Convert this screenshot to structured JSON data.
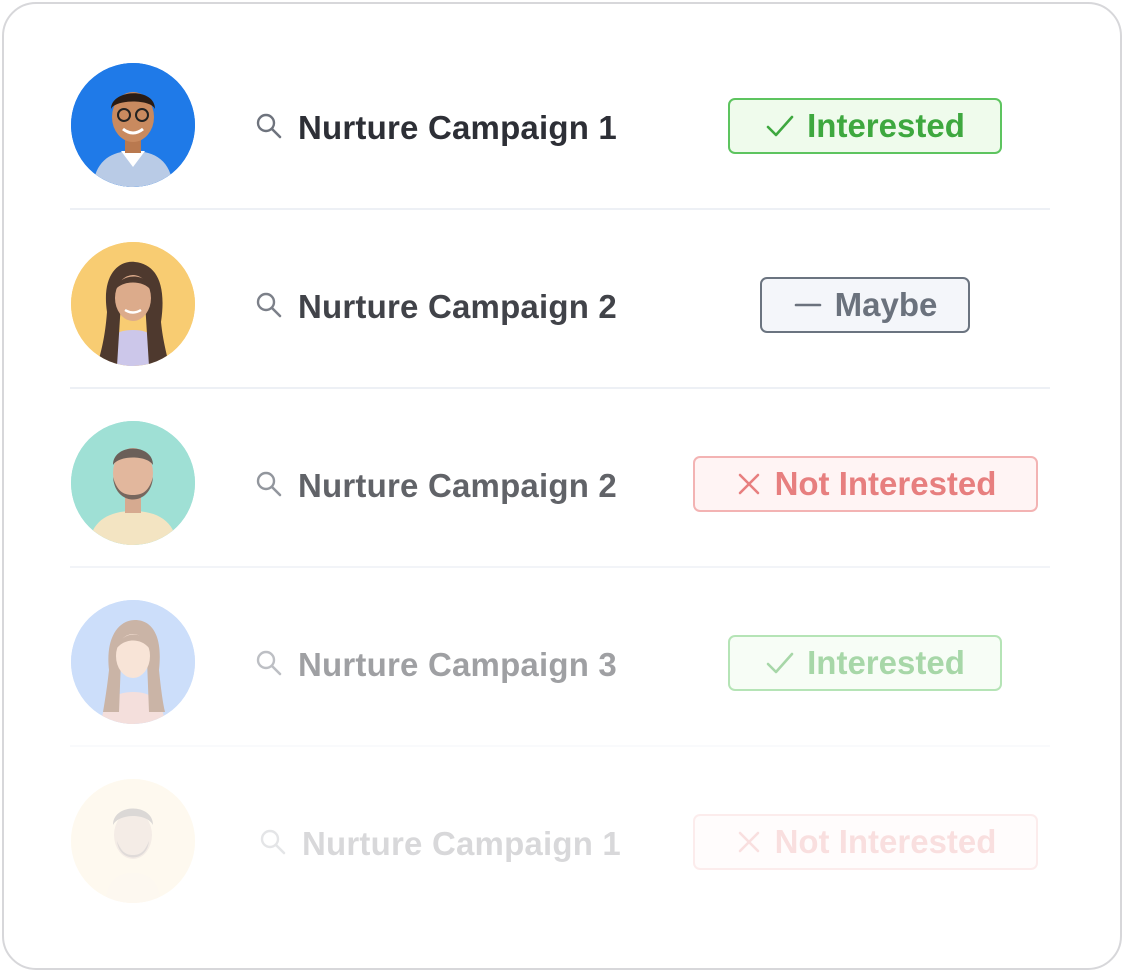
{
  "rows": [
    {
      "campaign": "Nurture Campaign 1",
      "status": "Interested",
      "status_icon": "check-icon",
      "avatar_bg": "#1f7ae8",
      "opacity": 1
    },
    {
      "campaign": "Nurture Campaign 2",
      "status": "Maybe",
      "status_icon": "minus-icon",
      "avatar_bg": "#f8c763",
      "opacity": 0.9
    },
    {
      "campaign": "Nurture Campaign 2",
      "status": "Not Interested",
      "status_icon": "x-icon",
      "avatar_bg": "#7fd6c8",
      "opacity": 0.75
    },
    {
      "campaign": "Nurture Campaign 3",
      "status": "Interested",
      "status_icon": "check-icon",
      "avatar_bg": "#8fb8f6",
      "opacity": 0.45
    },
    {
      "campaign": "Nurture Campaign 1",
      "status": "Not Interested",
      "status_icon": "x-icon",
      "avatar_bg": "#fbe3a8",
      "opacity": 0.18
    }
  ],
  "colors": {
    "interested": "#3ea83f",
    "maybe": "#5b6370",
    "not_interested": "#e05555",
    "card_border": "#d7d7da"
  }
}
